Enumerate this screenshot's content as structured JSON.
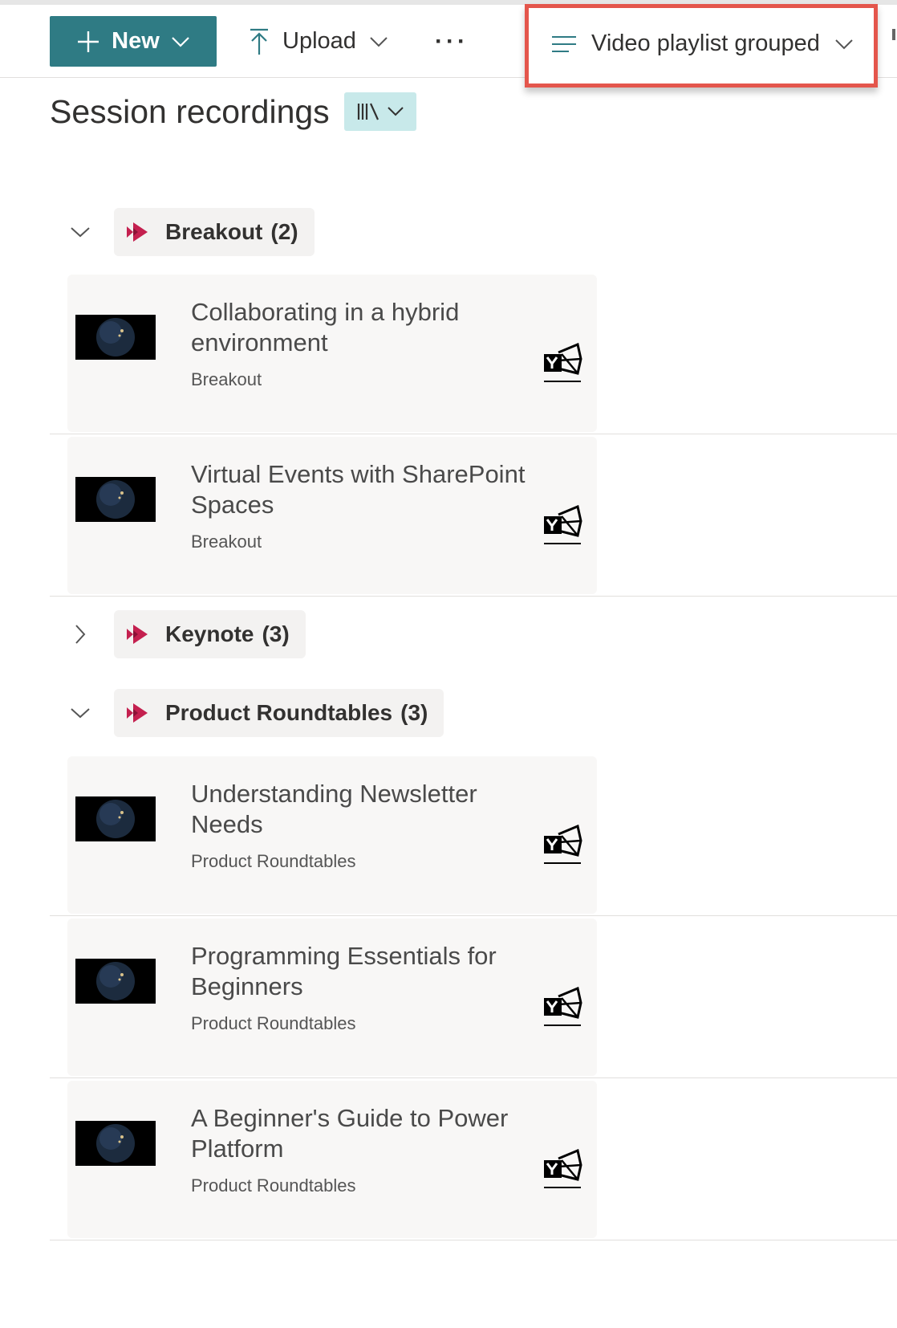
{
  "commandbar": {
    "new_label": "New",
    "upload_label": "Upload",
    "more_label": "···",
    "view_label": "Video playlist grouped"
  },
  "page": {
    "title": "Session recordings"
  },
  "groups": [
    {
      "name": "Breakout",
      "count": "(2)",
      "expanded": true,
      "items": [
        {
          "title": "Collaborating in a hybrid environment",
          "category": "Breakout"
        },
        {
          "title": "Virtual Events with SharePoint Spaces",
          "category": "Breakout"
        }
      ]
    },
    {
      "name": "Keynote",
      "count": "(3)",
      "expanded": false,
      "items": []
    },
    {
      "name": "Product Roundtables",
      "count": "(3)",
      "expanded": true,
      "items": [
        {
          "title": "Understanding Newsletter Needs",
          "category": "Product Roundtables"
        },
        {
          "title": "Programming Essentials for Beginners",
          "category": "Product Roundtables"
        },
        {
          "title": "A Beginner's Guide to Power Platform",
          "category": "Product Roundtables"
        }
      ]
    }
  ],
  "icons": {
    "group_icon": "stream-play-icon",
    "item_action_icon": "yammer-icon",
    "thumbnail": "earth-thumbnail"
  },
  "colors": {
    "primary_button": "#2f7b84",
    "highlight_border": "#e4564c",
    "library_button": "#c8e9ea",
    "stream_icon": "#c4204f"
  }
}
